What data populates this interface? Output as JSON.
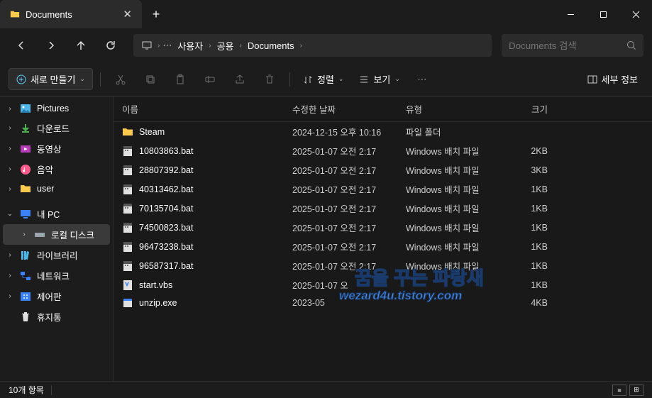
{
  "titlebar": {
    "tab_title": "Documents",
    "new_tab": "+"
  },
  "nav": {
    "breadcrumb": [
      "사용자",
      "공용",
      "Documents"
    ],
    "search_placeholder": "Documents 검색"
  },
  "toolbar": {
    "new_label": "새로 만들기",
    "sort_label": "정렬",
    "view_label": "보기",
    "details_label": "세부 정보"
  },
  "columns": {
    "name": "이름",
    "date": "수정한 날짜",
    "type": "유형",
    "size": "크기"
  },
  "sidebar": [
    {
      "label": "Pictures",
      "icon": "picture",
      "twisty": "›"
    },
    {
      "label": "다운로드",
      "icon": "download",
      "twisty": "›"
    },
    {
      "label": "동영상",
      "icon": "video",
      "twisty": "›"
    },
    {
      "label": "음악",
      "icon": "music",
      "twisty": "›"
    },
    {
      "label": "user",
      "icon": "folder",
      "twisty": "›"
    },
    {
      "label": "내 PC",
      "icon": "pc",
      "twisty": "⌄",
      "gap_before": true
    },
    {
      "label": "로컬 디스크",
      "icon": "disk",
      "twisty": "›",
      "selected": true,
      "sub": true
    },
    {
      "label": "라이브러리",
      "icon": "library",
      "twisty": "›"
    },
    {
      "label": "네트워크",
      "icon": "network",
      "twisty": "›"
    },
    {
      "label": "제어판",
      "icon": "control",
      "twisty": "›"
    },
    {
      "label": "휴지통",
      "icon": "trash",
      "twisty": ""
    }
  ],
  "files": [
    {
      "name": "Steam",
      "date": "2024-12-15 오후 10:16",
      "type": "파일 폴더",
      "size": "",
      "icon": "folder"
    },
    {
      "name": "10803863.bat",
      "date": "2025-01-07 오전 2:17",
      "type": "Windows 배치 파일",
      "size": "2KB",
      "icon": "bat"
    },
    {
      "name": "28807392.bat",
      "date": "2025-01-07 오전 2:17",
      "type": "Windows 배치 파일",
      "size": "3KB",
      "icon": "bat"
    },
    {
      "name": "40313462.bat",
      "date": "2025-01-07 오전 2:17",
      "type": "Windows 배치 파일",
      "size": "1KB",
      "icon": "bat"
    },
    {
      "name": "70135704.bat",
      "date": "2025-01-07 오전 2:17",
      "type": "Windows 배치 파일",
      "size": "1KB",
      "icon": "bat"
    },
    {
      "name": "74500823.bat",
      "date": "2025-01-07 오전 2:17",
      "type": "Windows 배치 파일",
      "size": "1KB",
      "icon": "bat"
    },
    {
      "name": "96473238.bat",
      "date": "2025-01-07 오전 2:17",
      "type": "Windows 배치 파일",
      "size": "1KB",
      "icon": "bat"
    },
    {
      "name": "96587317.bat",
      "date": "2025-01-07 오전 2:17",
      "type": "Windows 배치 파일",
      "size": "1KB",
      "icon": "bat"
    },
    {
      "name": "start.vbs",
      "date": "2025-01-07 오",
      "type": "",
      "size": "1KB",
      "icon": "vbs"
    },
    {
      "name": "unzip.exe",
      "date": "2023-05",
      "type": "",
      "size": "4KB",
      "icon": "exe"
    }
  ],
  "status": {
    "count": "10개 항목"
  },
  "watermark": {
    "line1": "꿈을 꾸는 파랑새",
    "line2": "wezard4u.tistory.com"
  }
}
